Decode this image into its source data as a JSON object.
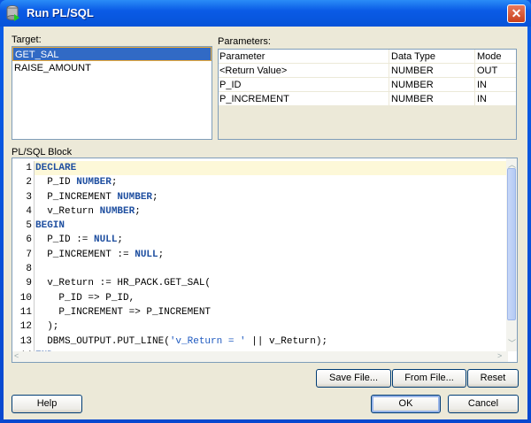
{
  "window": {
    "title": "Run PL/SQL",
    "icon": "database-run-icon"
  },
  "target": {
    "label": "Target:",
    "items": [
      {
        "label": "GET_SAL",
        "selected": true
      },
      {
        "label": "RAISE_AMOUNT",
        "selected": false
      }
    ]
  },
  "parameters": {
    "label": "Parameters:",
    "columns": [
      "Parameter",
      "Data Type",
      "Mode"
    ],
    "rows": [
      [
        "<Return Value>",
        "NUMBER",
        "OUT"
      ],
      [
        "P_ID",
        "NUMBER",
        "IN"
      ],
      [
        "P_INCREMENT",
        "NUMBER",
        "IN"
      ]
    ]
  },
  "block": {
    "label": "PL/SQL Block",
    "lines": [
      [
        [
          "kw",
          "DECLARE"
        ]
      ],
      [
        [
          "t",
          "  P_ID "
        ],
        [
          "kw",
          "NUMBER"
        ],
        [
          "t",
          ";"
        ]
      ],
      [
        [
          "t",
          "  P_INCREMENT "
        ],
        [
          "kw",
          "NUMBER"
        ],
        [
          "t",
          ";"
        ]
      ],
      [
        [
          "t",
          "  v_Return "
        ],
        [
          "kw",
          "NUMBER"
        ],
        [
          "t",
          ";"
        ]
      ],
      [
        [
          "kw",
          "BEGIN"
        ]
      ],
      [
        [
          "t",
          "  P_ID := "
        ],
        [
          "kw",
          "NULL"
        ],
        [
          "t",
          ";"
        ]
      ],
      [
        [
          "t",
          "  P_INCREMENT := "
        ],
        [
          "kw",
          "NULL"
        ],
        [
          "t",
          ";"
        ]
      ],
      [],
      [
        [
          "t",
          "  v_Return := HR_PACK.GET_SAL("
        ]
      ],
      [
        [
          "t",
          "    P_ID => P_ID,"
        ]
      ],
      [
        [
          "t",
          "    P_INCREMENT => P_INCREMENT"
        ]
      ],
      [
        [
          "t",
          "  );"
        ]
      ],
      [
        [
          "t",
          "  DBMS_OUTPUT.PUT_LINE("
        ],
        [
          "str",
          "'v_Return = '"
        ],
        [
          "t",
          " || v_Return);"
        ]
      ],
      [
        [
          "kw",
          "END"
        ],
        [
          "t",
          ";"
        ]
      ]
    ]
  },
  "buttons": {
    "save": "Save File...",
    "from": "From File...",
    "reset": "Reset",
    "help": "Help",
    "ok": "OK",
    "cancel": "Cancel"
  }
}
